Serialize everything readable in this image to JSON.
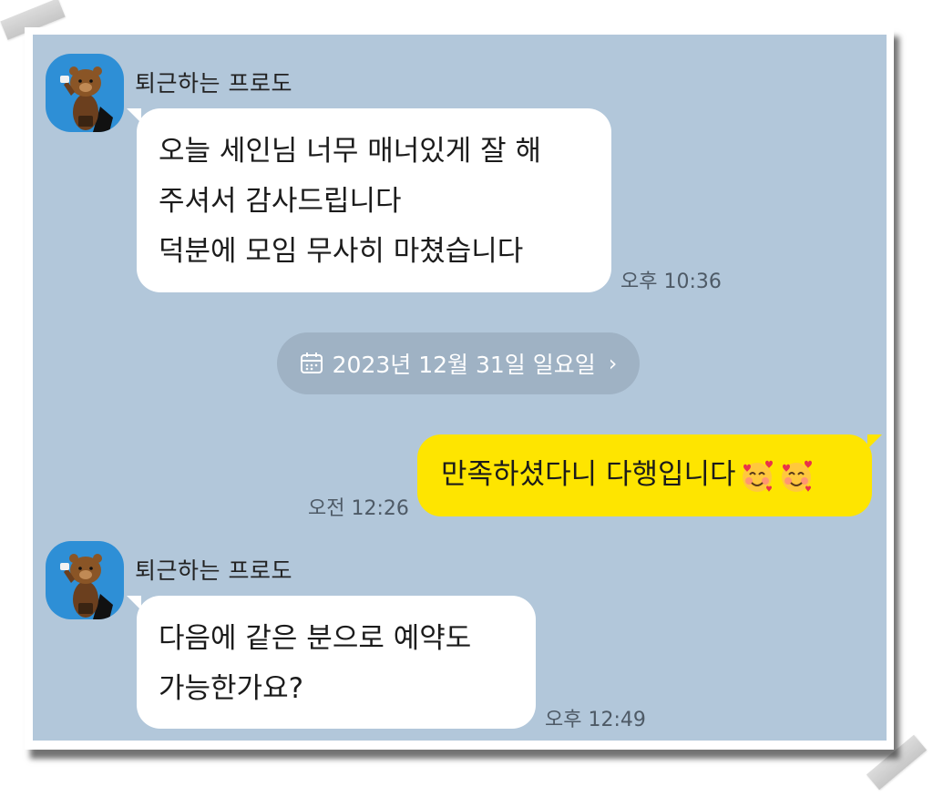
{
  "colors": {
    "chat_background": "#b2c7da",
    "incoming_bubble": "#ffffff",
    "outgoing_bubble": "#fee500",
    "date_pill": "#9fb2c4"
  },
  "date_divider": {
    "icon": "calendar-icon",
    "label": "2023년 12월 31일 일요일",
    "chevron": "›"
  },
  "messages": [
    {
      "sender": "퇴근하는 프로도",
      "lines": [
        "오늘 세인님 너무 매너있게 잘 해",
        "주셔서 감사드립니다",
        "덕분에 모임 무사히 마쳤습니다"
      ],
      "time": "오후 10:36"
    },
    {
      "outgoing": true,
      "lines": [
        "만족하셨다니 다행입니다"
      ],
      "emoji": [
        "smiling-face-with-hearts-icon",
        "smiling-face-with-hearts-icon"
      ],
      "time": "오전 12:26"
    },
    {
      "sender": "퇴근하는 프로도",
      "lines": [
        "다음에 같은 분으로 예약도",
        "가능한가요?"
      ],
      "time": "오후 12:49"
    }
  ]
}
